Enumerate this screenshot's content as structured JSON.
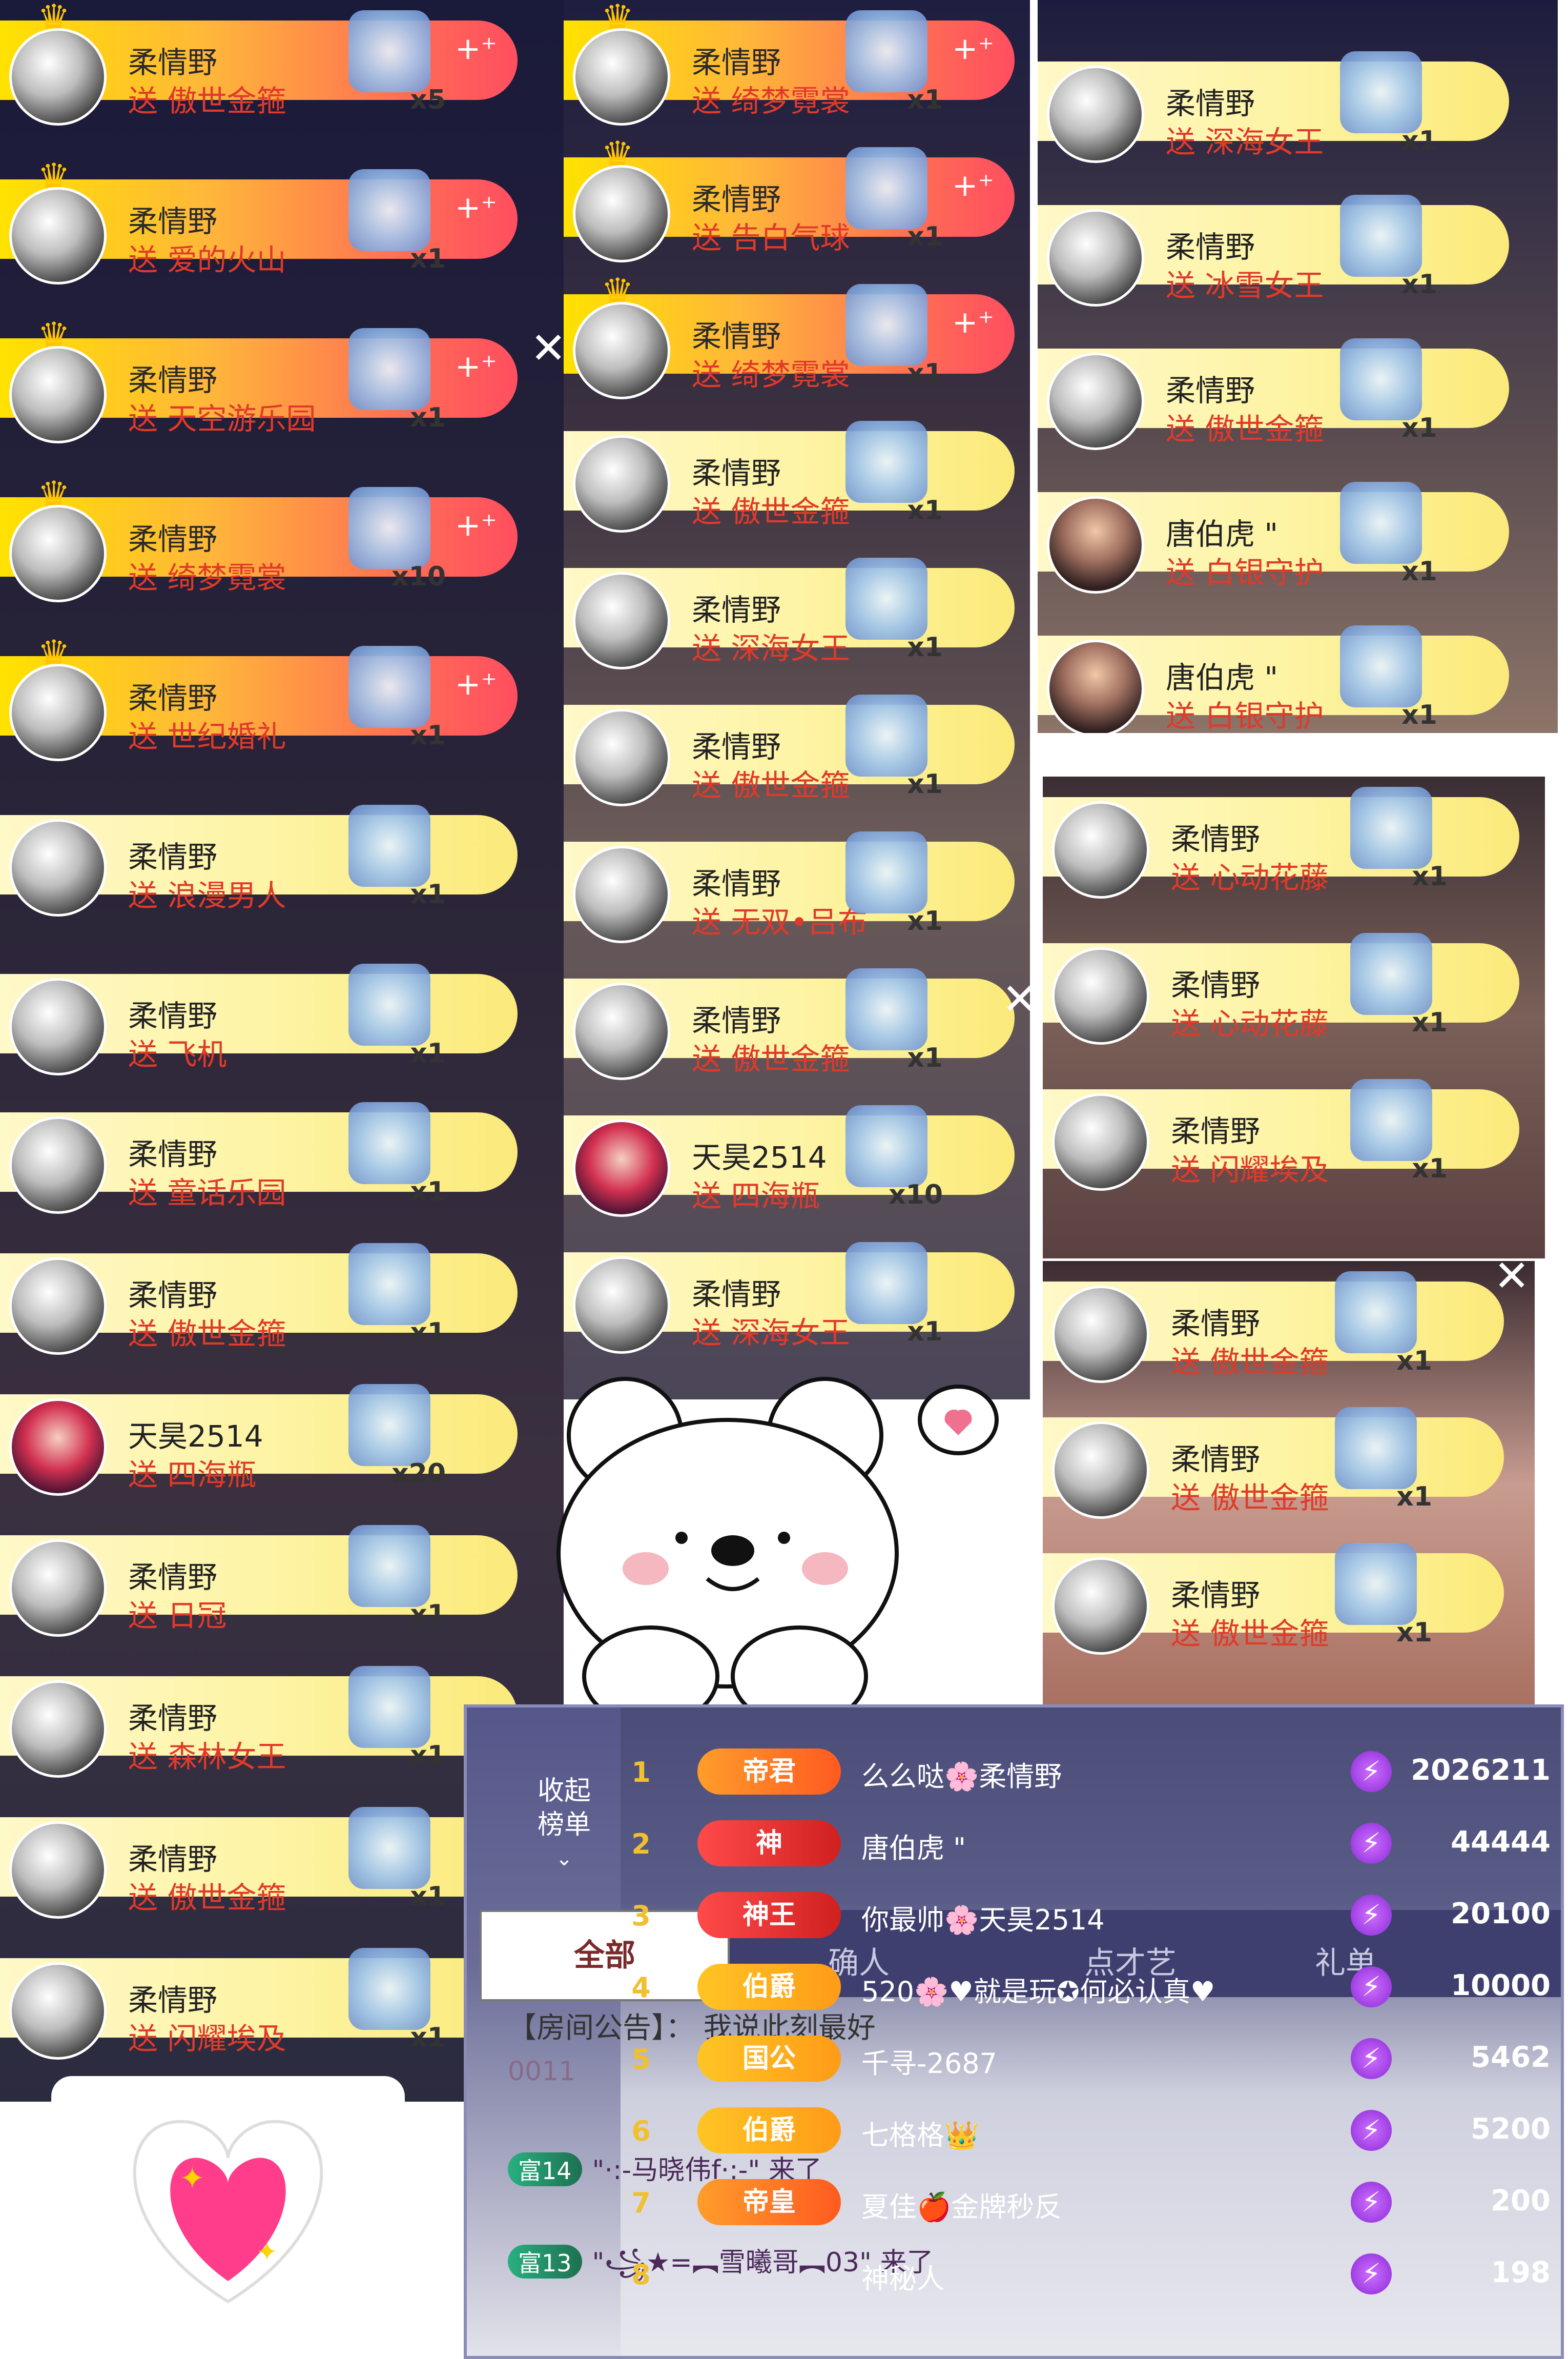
{
  "columns": [
    {
      "gifts": [
        {
          "style": "gold",
          "sender": "柔情野",
          "verb": "送",
          "gift": "傲世金箍",
          "count": "x5"
        },
        {
          "style": "gold",
          "sender": "柔情野",
          "verb": "送",
          "gift": "爱的火山",
          "count": "x1"
        },
        {
          "style": "gold",
          "sender": "柔情野",
          "verb": "送",
          "gift": "天空游乐园",
          "count": "x1"
        },
        {
          "style": "gold",
          "sender": "柔情野",
          "verb": "送",
          "gift": "绮梦霓裳",
          "count": "x10"
        },
        {
          "style": "gold",
          "sender": "柔情野",
          "verb": "送",
          "gift": "世纪婚礼",
          "count": "x1"
        },
        {
          "style": "pale",
          "sender": "柔情野",
          "verb": "送",
          "gift": "浪漫男人",
          "count": "x1"
        },
        {
          "style": "pale",
          "sender": "柔情野",
          "verb": "送",
          "gift": "飞机",
          "count": "x1"
        },
        {
          "style": "pale",
          "sender": "柔情野",
          "verb": "送",
          "gift": "童话乐园",
          "count": "x1"
        },
        {
          "style": "pale",
          "sender": "柔情野",
          "verb": "送",
          "gift": "傲世金箍",
          "count": "x1"
        },
        {
          "style": "pale",
          "sender": "天昊2514",
          "verb": "送",
          "gift": "四海瓶",
          "count": "x20"
        },
        {
          "style": "pale",
          "sender": "柔情野",
          "verb": "送",
          "gift": "日冠",
          "count": "x1"
        },
        {
          "style": "pale",
          "sender": "柔情野",
          "verb": "送",
          "gift": "森林女王",
          "count": "x1"
        },
        {
          "style": "pale",
          "sender": "柔情野",
          "verb": "送",
          "gift": "傲世金箍",
          "count": "x1"
        },
        {
          "style": "pale",
          "sender": "柔情野",
          "verb": "送",
          "gift": "闪耀埃及",
          "count": "x1"
        }
      ]
    },
    {
      "gifts": [
        {
          "style": "gold",
          "sender": "柔情野",
          "verb": "送",
          "gift": "绮梦霓裳",
          "count": "x1"
        },
        {
          "style": "gold",
          "sender": "柔情野",
          "verb": "送",
          "gift": "告白气球",
          "count": "x1"
        },
        {
          "style": "gold",
          "sender": "柔情野",
          "verb": "送",
          "gift": "绮梦霓裳",
          "count": "x1"
        },
        {
          "style": "pale",
          "sender": "柔情野",
          "verb": "送",
          "gift": "傲世金箍",
          "count": "x1"
        },
        {
          "style": "pale",
          "sender": "柔情野",
          "verb": "送",
          "gift": "深海女王",
          "count": "x1"
        },
        {
          "style": "pale",
          "sender": "柔情野",
          "verb": "送",
          "gift": "傲世金箍",
          "count": "x1"
        },
        {
          "style": "pale",
          "sender": "柔情野",
          "verb": "送",
          "gift": "无双•吕布",
          "count": "x1"
        },
        {
          "style": "pale",
          "sender": "柔情野",
          "verb": "送",
          "gift": "傲世金箍",
          "count": "x1"
        },
        {
          "style": "pale",
          "sender": "天昊2514",
          "verb": "送",
          "gift": "四海瓶",
          "count": "x10"
        },
        {
          "style": "pale",
          "sender": "柔情野",
          "verb": "送",
          "gift": "深海女王",
          "count": "x1"
        }
      ]
    },
    {
      "gifts": [
        {
          "style": "pale",
          "sender": "柔情野",
          "verb": "送",
          "gift": "深海女王",
          "count": "x1"
        },
        {
          "style": "pale",
          "sender": "柔情野",
          "verb": "送",
          "gift": "冰雪女王",
          "count": "x1"
        },
        {
          "style": "pale",
          "sender": "柔情野",
          "verb": "送",
          "gift": "傲世金箍",
          "count": "x1"
        },
        {
          "style": "pale",
          "sender": "唐伯虎 \"",
          "verb": "送",
          "gift": "白银守护",
          "count": "x1"
        },
        {
          "style": "pale",
          "sender": "唐伯虎 \"",
          "verb": "送",
          "gift": "白银守护",
          "count": "x1"
        }
      ]
    },
    {
      "gifts": [
        {
          "style": "pale",
          "sender": "柔情野",
          "verb": "送",
          "gift": "心动花藤",
          "count": "x1"
        },
        {
          "style": "pale",
          "sender": "柔情野",
          "verb": "送",
          "gift": "心动花藤",
          "count": "x1"
        },
        {
          "style": "pale",
          "sender": "柔情野",
          "verb": "送",
          "gift": "闪耀埃及",
          "count": "x1"
        }
      ]
    },
    {
      "gifts": [
        {
          "style": "pale",
          "sender": "柔情野",
          "verb": "送",
          "gift": "傲世金箍",
          "count": "x1"
        },
        {
          "style": "pale",
          "sender": "柔情野",
          "verb": "送",
          "gift": "傲世金箍",
          "count": "x1"
        },
        {
          "style": "pale",
          "sender": "柔情野",
          "verb": "送",
          "gift": "傲世金箍",
          "count": "x1"
        }
      ]
    }
  ],
  "board": {
    "collapse_label": "收起\n榜单",
    "tab_all": "全部",
    "tabs": [
      "确人",
      "点才艺",
      "礼单"
    ],
    "notice": "【房间公告】：  我说此刻最好",
    "ranks": [
      {
        "rank": "1",
        "title": "帝君",
        "name": "么么哒🌸柔情野",
        "score": "2026211"
      },
      {
        "rank": "2",
        "title": "神",
        "name": "唐伯虎 \"",
        "score": "44444"
      },
      {
        "rank": "3",
        "title": "神王",
        "name": "你最帅🌸天昊2514",
        "score": "20100"
      },
      {
        "rank": "4",
        "title": "伯爵",
        "name": "520🌸♥就是玩✪何必认真♥",
        "score": "10000"
      },
      {
        "rank": "5",
        "title": "国公",
        "name": "千寻-2687",
        "score": "5462"
      },
      {
        "rank": "6",
        "title": "伯爵",
        "name": "七格格👑",
        "score": "5200"
      },
      {
        "rank": "7",
        "title": "帝皇",
        "name": "夏佳🍎金牌秒反",
        "score": "200"
      },
      {
        "rank": "8",
        "title": "",
        "name": "神秘人",
        "score": "198"
      }
    ],
    "chat": [
      {
        "badge": "富14",
        "text": "\"·:-马晓伟f·:-\"  来了"
      },
      {
        "badge": "富13",
        "text": "\"꧁★=︻雪曦哥︻03\"  来了"
      }
    ],
    "partial_text": "0011"
  }
}
